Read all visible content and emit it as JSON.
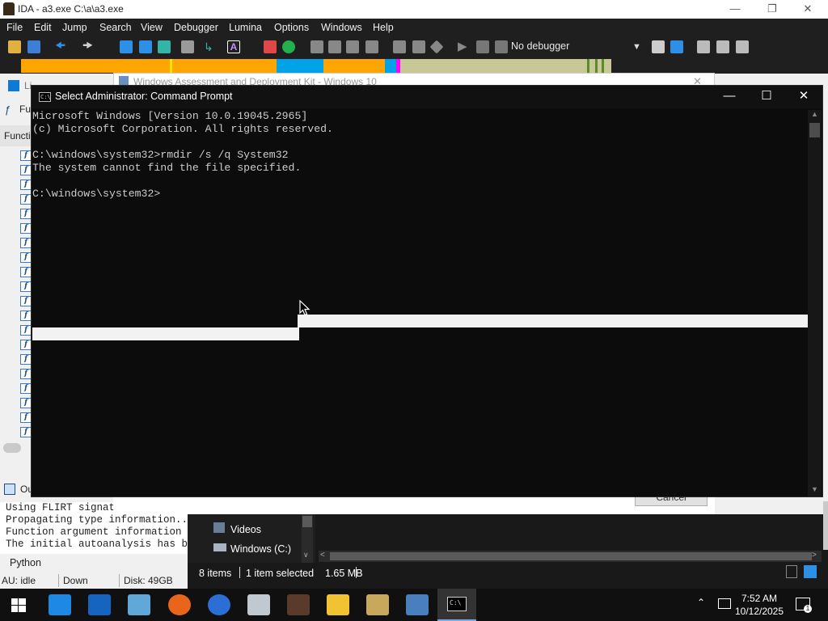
{
  "ida": {
    "title": "IDA - a3.exe C:\\a\\a3.exe",
    "menu": [
      "File",
      "Edit",
      "Jump",
      "Search",
      "View",
      "Debugger",
      "Lumina",
      "Options",
      "Windows",
      "Help"
    ],
    "debugger_select": "No debugger",
    "left_tabs": {
      "library_tab": "Li",
      "functions_tab": "Fu",
      "functions_header": "Functi",
      "output_tab": "Ou"
    },
    "output_lines": [
      "Using FLIRT signatu",
      "Propagating type information...",
      "Function argument information ha",
      "The initial autoanalysis has bee"
    ],
    "python_label": "Python",
    "status": {
      "au": "AU:  idle",
      "direction": "Down",
      "disk": "Disk: 49GB"
    },
    "nav_colors": {
      "library": "#00a2e8",
      "regular": "#ffa500",
      "data": "#c8c896",
      "lumina": "#ff00ff"
    }
  },
  "adk": {
    "title": "Windows Assessment and Deployment Kit - Windows 10",
    "cancel_label": "Cancel"
  },
  "explorer": {
    "tree_items": [
      {
        "label": "Videos",
        "icon": "videos-icon"
      },
      {
        "label": "Windows (C:)",
        "icon": "drive-icon"
      }
    ],
    "status": {
      "items": "8 items",
      "selected": "1 item selected",
      "size": "1.65 MB"
    }
  },
  "cmd": {
    "title": "Select Administrator: Command Prompt",
    "lines": [
      "Microsoft Windows [Version 10.0.19045.2965]",
      "(c) Microsoft Corporation. All rights reserved.",
      "",
      "C:\\windows\\system32>rmdir /s /q System32",
      "The system cannot find the file specified.",
      "",
      "C:\\windows\\system32>"
    ]
  },
  "taskbar": {
    "apps": [
      "start-icon",
      "search-app-icon",
      "ida-app-icon",
      "notepad-app-icon",
      "firefox-app-icon",
      "edge-app-icon",
      "explorer-app-icon",
      "portrait-app-icon",
      "folder-app-icon",
      "ida-x-app-icon",
      "tools-app-icon",
      "cmd-app-icon"
    ],
    "time": "7:52 AM",
    "date": "10/12/2025"
  }
}
